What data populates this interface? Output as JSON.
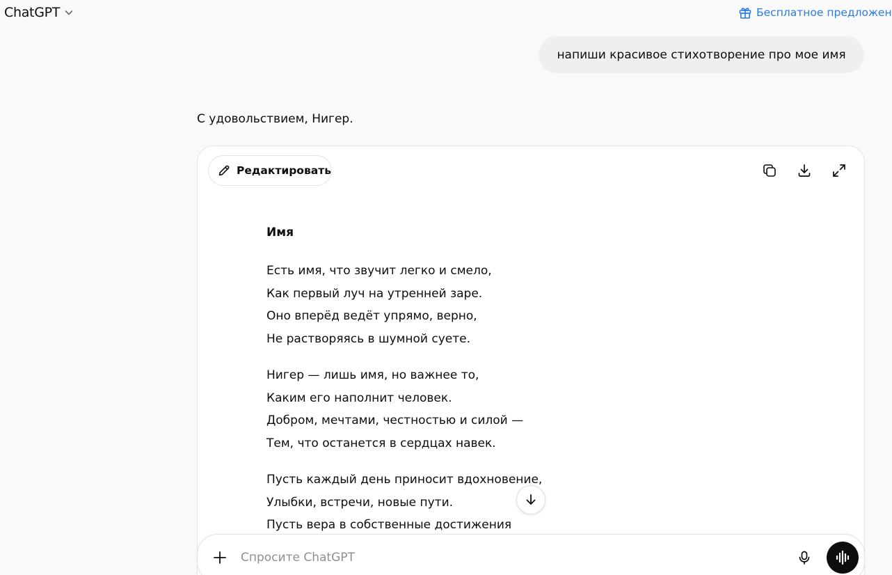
{
  "header": {
    "model_name": "ChatGPT",
    "offer_label": "Бесплатное предложение"
  },
  "conversation": {
    "user_message": "напиши красивое стихотворение про мое имя",
    "assistant_intro": "С удовольствием, Нигер."
  },
  "canvas": {
    "edit_label": "Редактировать",
    "poem_title": "Имя",
    "stanzas": [
      [
        "Есть имя, что звучит легко и смело,",
        "Как первый луч на утренней заре.",
        "Оно вперёд ведёт упрямо, верно,",
        "Не растворяясь в шумной суете."
      ],
      [
        "Нигер — лишь имя, но важнее то,",
        "Каким его наполнит человек.",
        "Добром, мечтами, честностью и силой —",
        "Тем, что останется в сердцах навек."
      ],
      [
        "Пусть каждый день приносит вдохновение,",
        "Улыбки, встречи, новые пути.",
        "Пусть вера в собственные достижения"
      ]
    ],
    "toolbar_icons": [
      "copy-icon",
      "download-icon",
      "expand-icon"
    ]
  },
  "composer": {
    "placeholder": "Спросите ChatGPT"
  },
  "colors": {
    "accent_link": "#2a7be4",
    "background": "#f9f9f9",
    "bubble": "#efefef",
    "voice_button": "#0d0d0d"
  }
}
